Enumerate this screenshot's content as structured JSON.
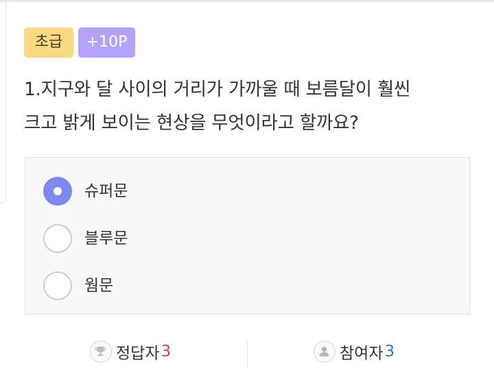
{
  "quiz": {
    "level_badge": "초급",
    "points_badge": "+10P",
    "question_line1": "1.지구와 달 사이의 거리가 가까울 때 보름달이 훨씬",
    "question_line2": "크고 밝게 보이는 현상을 무엇이라고 할까요?",
    "options": [
      {
        "label": "슈퍼문",
        "selected": true
      },
      {
        "label": "블루문",
        "selected": false
      },
      {
        "label": "웜문",
        "selected": false
      }
    ]
  },
  "stats": {
    "correct_label": "정답자",
    "correct_count": "3",
    "participants_label": "참여자",
    "participants_count": "3"
  },
  "colors": {
    "level_badge_bg": "#fbd982",
    "points_badge_bg": "#b3a2f6",
    "selected_radio": "#7d88f2",
    "correct_count": "#d9404b",
    "participants_count": "#3a74c9"
  },
  "icons": {
    "correct": "trophy-icon",
    "participants": "user-icon"
  }
}
